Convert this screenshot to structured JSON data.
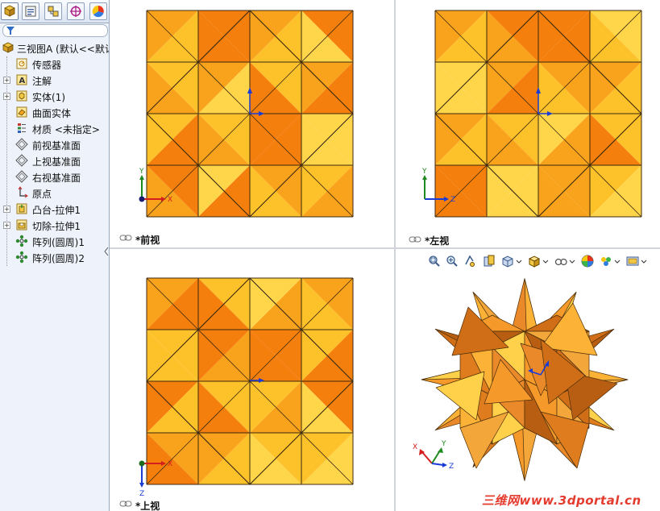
{
  "sidebar": {
    "tabs": [
      {
        "name": "feature-manager-tab",
        "icon": "feature-tree-icon"
      },
      {
        "name": "property-manager-tab",
        "icon": "property-icon"
      },
      {
        "name": "configuration-manager-tab",
        "icon": "configuration-icon"
      },
      {
        "name": "dimxpert-tab",
        "icon": "target-icon"
      },
      {
        "name": "display-manager-tab",
        "icon": "color-wheel-icon"
      }
    ],
    "filter_icon": "filter-icon",
    "root_label": "三视图A  (默认<<默认",
    "items": [
      {
        "label": "传感器",
        "icon": "sensor-icon",
        "expandable": false
      },
      {
        "label": "注解",
        "icon": "annotation-icon",
        "expandable": true
      },
      {
        "label": "实体(1)",
        "icon": "solid-body-icon",
        "expandable": true
      },
      {
        "label": "曲面实体",
        "icon": "surface-body-icon",
        "expandable": false
      },
      {
        "label": "材质 <未指定>",
        "icon": "material-icon",
        "expandable": false
      },
      {
        "label": "前视基准面",
        "icon": "plane-icon",
        "expandable": false
      },
      {
        "label": "上视基准面",
        "icon": "plane-icon",
        "expandable": false
      },
      {
        "label": "右视基准面",
        "icon": "plane-icon",
        "expandable": false
      },
      {
        "label": "原点",
        "icon": "origin-icon",
        "expandable": false
      },
      {
        "label": "凸台-拉伸1",
        "icon": "boss-extrude-icon",
        "expandable": true
      },
      {
        "label": "切除-拉伸1",
        "icon": "cut-extrude-icon",
        "expandable": true
      },
      {
        "label": "阵列(圆周)1",
        "icon": "circular-pattern-icon",
        "expandable": false
      },
      {
        "label": "阵列(圆周)2",
        "icon": "circular-pattern-icon",
        "expandable": false
      }
    ]
  },
  "viewports": {
    "front": {
      "label": "*前视",
      "axis_x": "X",
      "axis_y": "Y"
    },
    "left": {
      "label": "*左视",
      "axis_h": "Z",
      "axis_v": "Y"
    },
    "top": {
      "label": "*上视",
      "axis_x": "X",
      "axis_v": "Z"
    },
    "iso": {
      "axis_x": "X",
      "axis_y": "Y",
      "axis_z": "Z"
    }
  },
  "view_toolbar": {
    "icons": [
      "zoom-to-fit-icon",
      "zoom-to-area-icon",
      "previous-view-icon",
      "section-view-icon",
      "view-orientation-icon",
      "display-style-icon",
      "hide-show-items-icon",
      "edit-appearance-icon",
      "apply-scene-icon",
      "view-settings-icon"
    ]
  },
  "watermark": "三维网www.3dportal.cn",
  "colors": {
    "face_dark": "#f47f0c",
    "face_mid": "#f9a31c",
    "face_light": "#fdc22a",
    "face_yellow": "#ffd64a",
    "edge": "#3c2a10",
    "sidebar_bg": "#eef3fb"
  }
}
